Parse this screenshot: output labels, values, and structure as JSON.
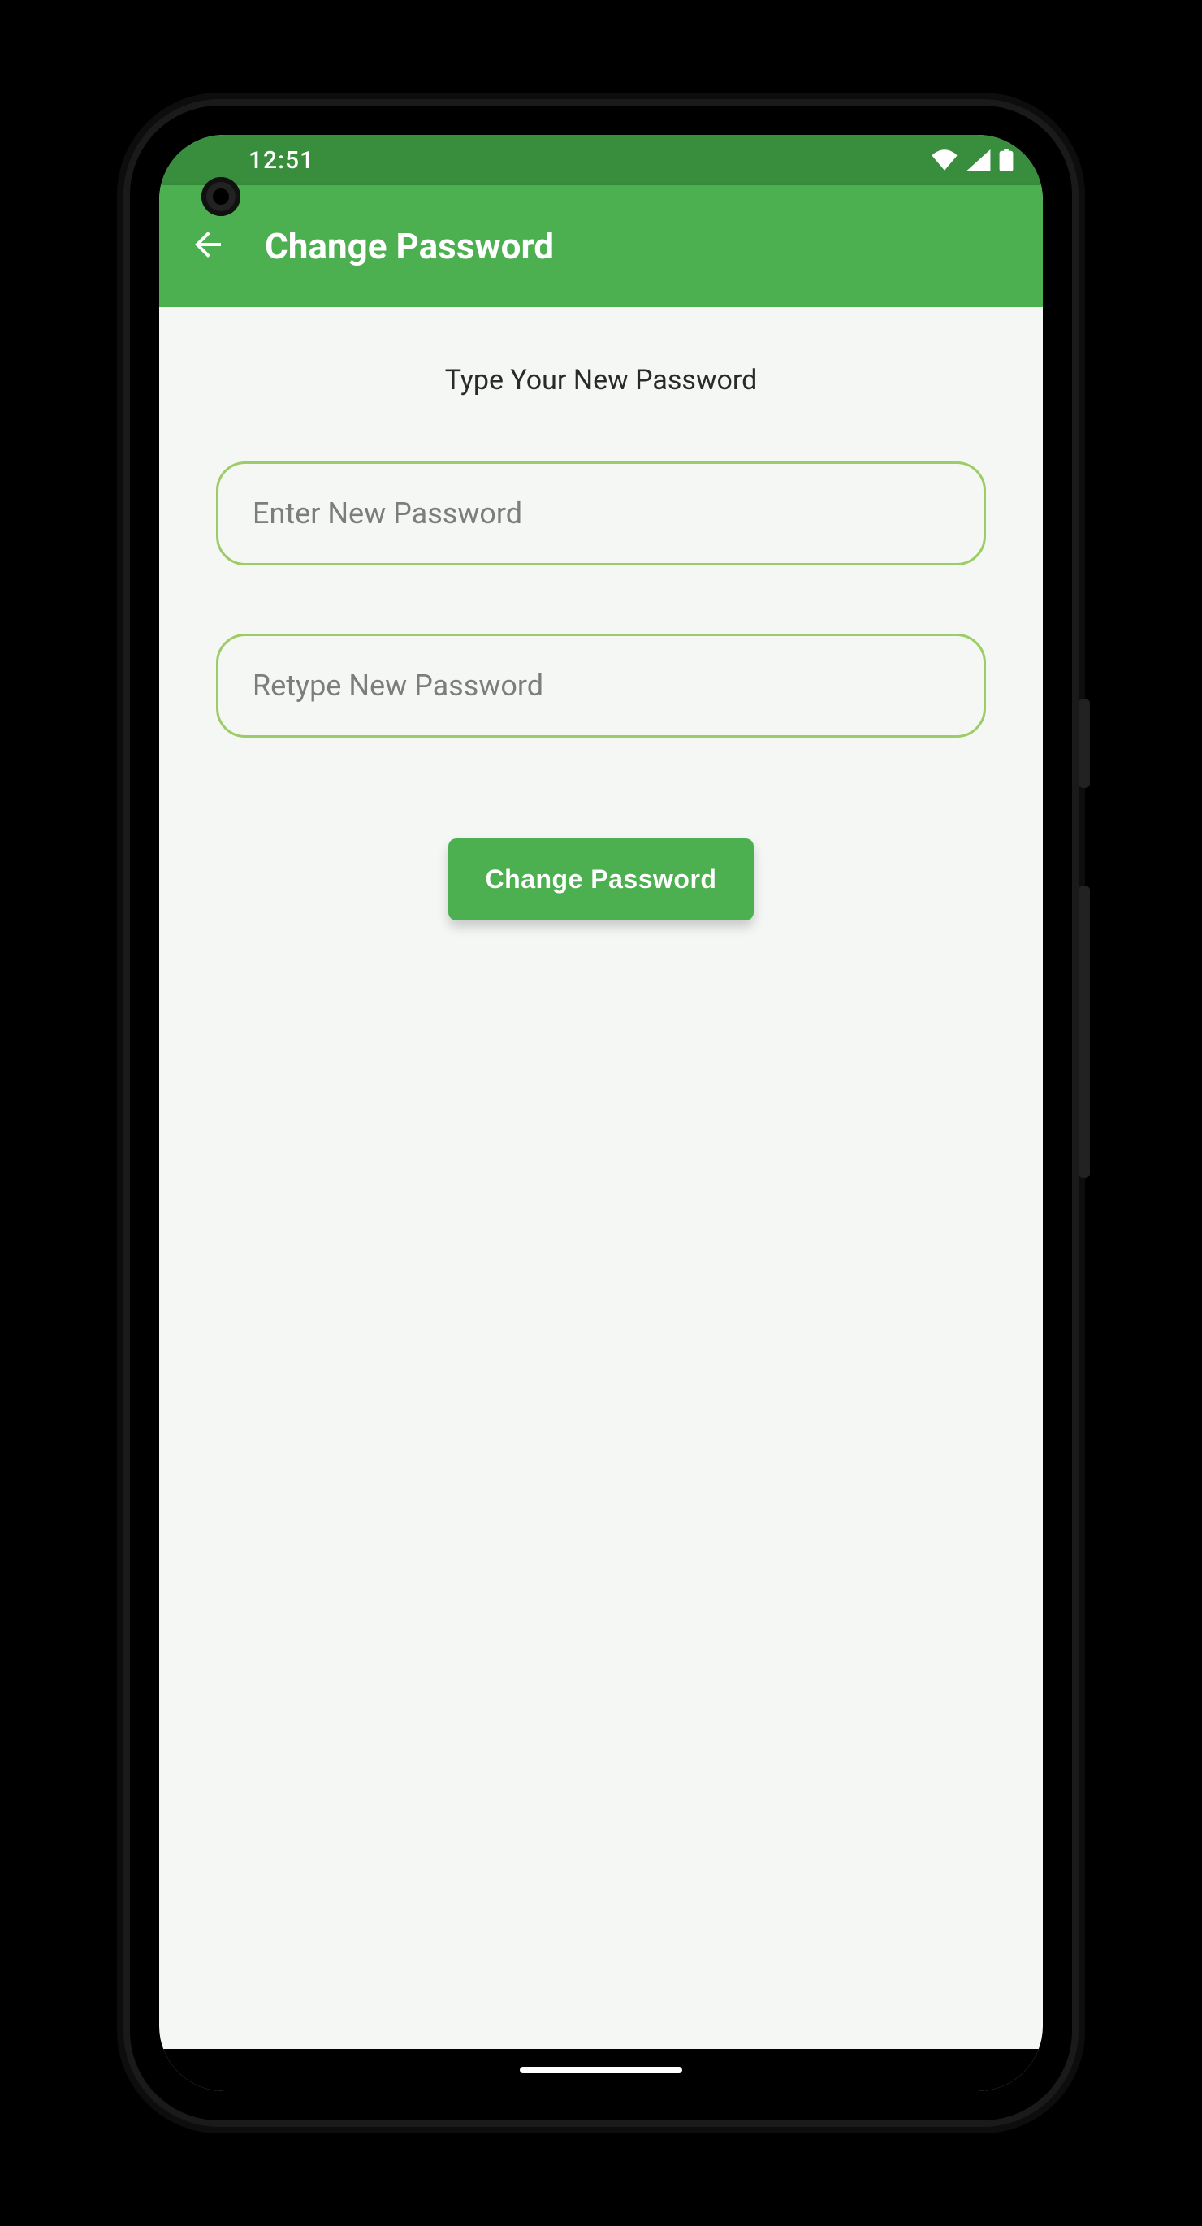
{
  "status": {
    "time": "12:51"
  },
  "app_bar": {
    "title": "Change Password"
  },
  "form": {
    "instruction": "Type Your New Password",
    "new_password_placeholder": "Enter New Password",
    "retype_password_placeholder": "Retype New Password",
    "submit_label": "Change Password"
  },
  "colors": {
    "primary": "#4CAF50",
    "primary_dark": "#388E3C",
    "input_border": "#9CCC65"
  }
}
